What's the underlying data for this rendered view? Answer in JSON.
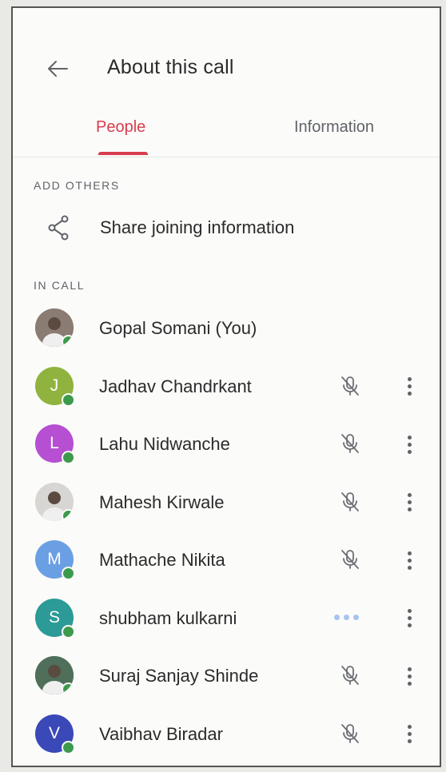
{
  "header": {
    "title": "About this call",
    "back_icon": "arrow-back-icon"
  },
  "tabs": [
    {
      "label": "People",
      "active": true
    },
    {
      "label": "Information",
      "active": false
    }
  ],
  "colors": {
    "accent": "#d93c4f",
    "presence": "#3c9a4d",
    "speaking": "#a9c4ee"
  },
  "add_others": {
    "section_label": "ADD OTHERS",
    "share_label": "Share joining information",
    "share_icon": "share-icon"
  },
  "in_call": {
    "section_label": "IN CALL",
    "people": [
      {
        "name": "Gopal Somani (You)",
        "initial": "",
        "avatar_color": "#8a7c72",
        "photo": true,
        "status": "none"
      },
      {
        "name": "Jadhav Chandrkant",
        "initial": "J",
        "avatar_color": "#8fb33e",
        "photo": false,
        "status": "muted"
      },
      {
        "name": "Lahu Nidwanche",
        "initial": "L",
        "avatar_color": "#b64fd2",
        "photo": false,
        "status": "muted"
      },
      {
        "name": "Mahesh Kirwale",
        "initial": "",
        "avatar_color": "#d8d6d3",
        "photo": true,
        "status": "muted"
      },
      {
        "name": "Mathache Nikita",
        "initial": "M",
        "avatar_color": "#6b9fe3",
        "photo": false,
        "status": "muted"
      },
      {
        "name": "shubham kulkarni",
        "initial": "S",
        "avatar_color": "#2c9a96",
        "photo": false,
        "status": "speaking"
      },
      {
        "name": "Suraj Sanjay Shinde",
        "initial": "",
        "avatar_color": "#4f6f5a",
        "photo": true,
        "status": "muted"
      },
      {
        "name": "Vaibhav Biradar",
        "initial": "V",
        "avatar_color": "#3a48b8",
        "photo": false,
        "status": "muted"
      }
    ]
  }
}
